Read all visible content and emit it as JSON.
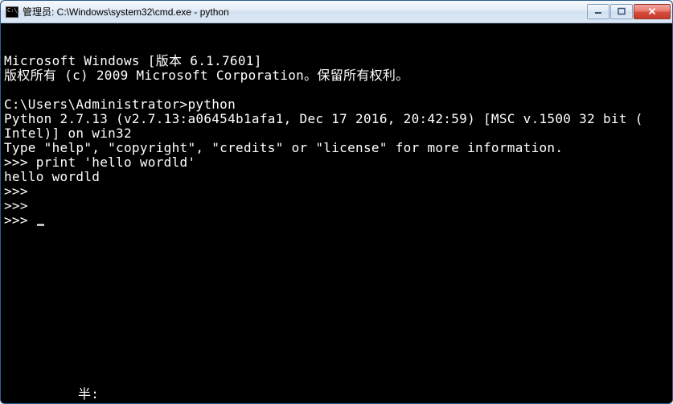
{
  "window": {
    "title": "管理员: C:\\Windows\\system32\\cmd.exe - python"
  },
  "terminal": {
    "lines": [
      "Microsoft Windows [版本 6.1.7601]",
      "版权所有 (c) 2009 Microsoft Corporation。保留所有权利。",
      "",
      "C:\\Users\\Administrator>python",
      "Python 2.7.13 (v2.7.13:a06454b1afa1, Dec 17 2016, 20:42:59) [MSC v.1500 32 bit (",
      "Intel)] on win32",
      "Type \"help\", \"copyright\", \"credits\" or \"license\" for more information.",
      ">>> print 'hello wordld'",
      "hello wordld",
      ">>> ",
      ">>> ",
      ">>> "
    ]
  },
  "ime": {
    "status": "半:"
  }
}
